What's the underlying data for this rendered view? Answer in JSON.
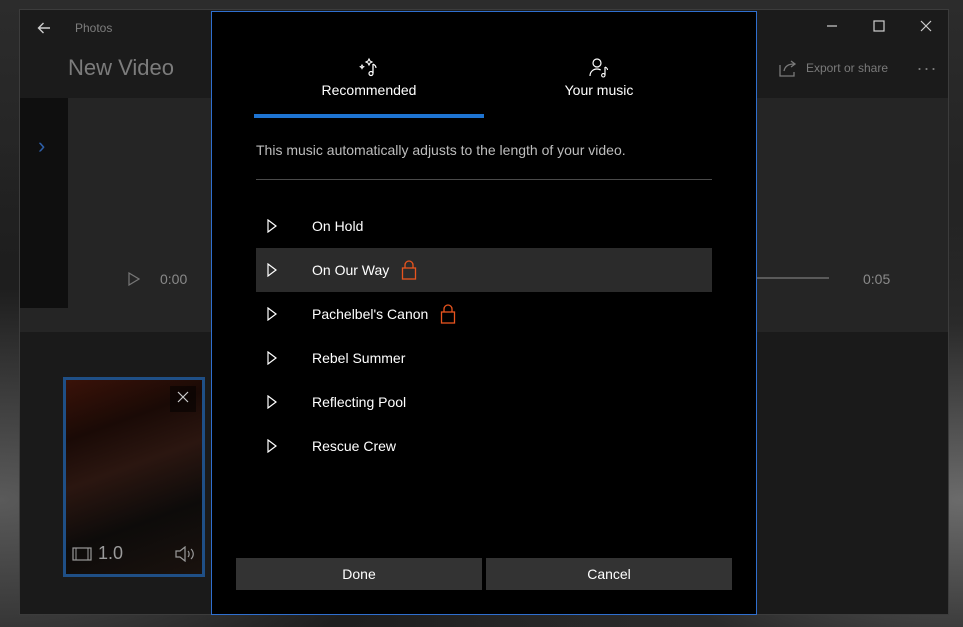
{
  "app": {
    "title": "Photos",
    "video_title": "New Video",
    "export_label": "Export or share",
    "more_label": "...",
    "window_controls": {
      "minimize": "minimize-icon",
      "maximize": "maximize-icon",
      "close": "close-icon"
    }
  },
  "preview": {
    "time_start": "0:00",
    "time_end": "0:05"
  },
  "storyboard": {
    "clip_duration": "1.0"
  },
  "dialog": {
    "tabs": [
      {
        "label": "Recommended",
        "icon": "magic-music-icon",
        "selected": true
      },
      {
        "label": "Your music",
        "icon": "user-music-icon",
        "selected": false
      }
    ],
    "description": "This music automatically adjusts to the length of your video.",
    "tracks": [
      {
        "name": "On Hold",
        "locked": false,
        "selected": false
      },
      {
        "name": "On Our Way",
        "locked": true,
        "selected": true
      },
      {
        "name": "Pachelbel's Canon",
        "locked": true,
        "selected": false
      },
      {
        "name": "Rebel Summer",
        "locked": false,
        "selected": false
      },
      {
        "name": "Reflecting Pool",
        "locked": false,
        "selected": false
      },
      {
        "name": "Rescue Crew",
        "locked": false,
        "selected": false
      },
      {
        "name": "",
        "locked": false,
        "selected": false
      }
    ],
    "done_label": "Done",
    "cancel_label": "Cancel"
  },
  "colors": {
    "accent": "#1e74d2",
    "lock": "#e8541e",
    "dialog_border": "#2f6fcf"
  }
}
